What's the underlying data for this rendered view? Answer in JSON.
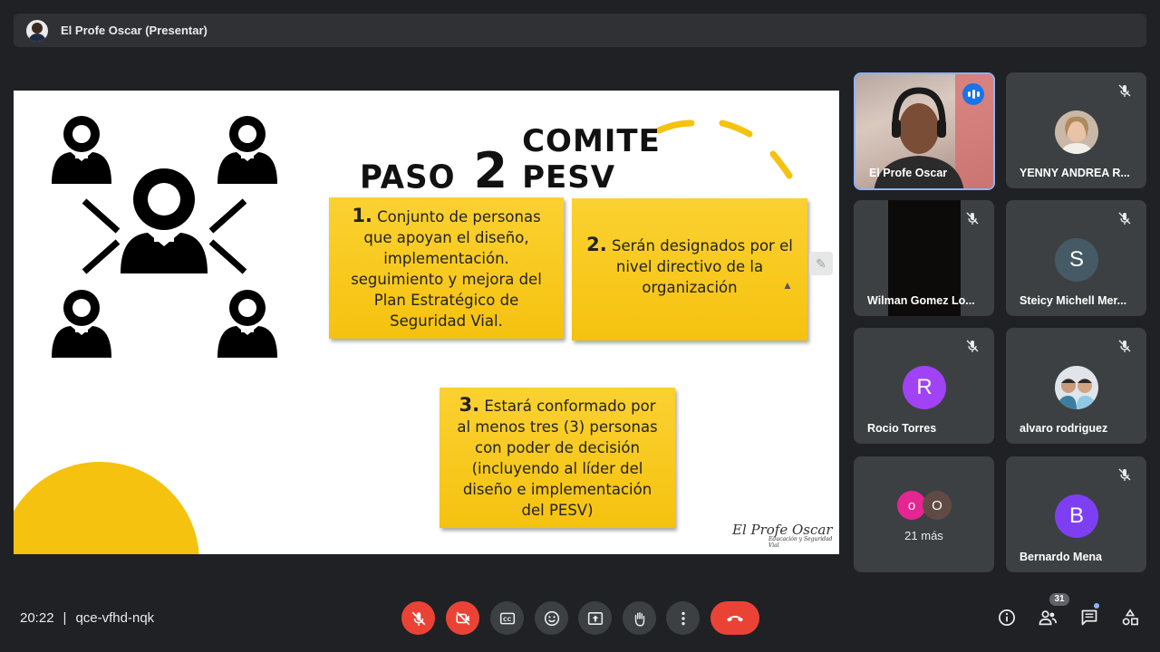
{
  "presenter_bar": {
    "title": "El Profe Oscar (Presentar)"
  },
  "slide": {
    "title_word1": "PASO",
    "title_number": "2",
    "title_word2": "COMITE PESV",
    "box1": {
      "num": "1.",
      "text": "Conjunto de personas que apoyan el diseño, implementación. seguimiento y mejora del Plan Estratégico de Seguridad Vial."
    },
    "box2": {
      "num": "2.",
      "text": "Serán designados por el nivel directivo de la organización"
    },
    "box3": {
      "num": "3.",
      "text": "Estará conformado por al menos tres (3) personas con poder de decisión (incluyendo al líder del diseño e implementación del PESV)"
    },
    "watermark": "El Profe Oscar",
    "watermark_sub": "Educación y Seguridad Vial",
    "accent_color": "#f5c20f"
  },
  "participants": [
    {
      "name": "El Profe Oscar",
      "speaking": true
    },
    {
      "name": "YENNY ANDREA R...",
      "muted": true
    },
    {
      "name": "Wilman Gomez Lo...",
      "muted": true
    },
    {
      "name": "Steicy Michell Mer...",
      "initial": "S",
      "color": "#455a64",
      "muted": true
    },
    {
      "name": "Rocio Torres",
      "initial": "R",
      "color": "#a142f4",
      "muted": true
    },
    {
      "name": "alvaro rodriguez",
      "muted": true
    },
    {
      "name": "Bernardo Mena",
      "initial": "B",
      "color": "#7e3ff2",
      "muted": true
    }
  ],
  "more_tile": {
    "dot1": "o",
    "dot2": "O",
    "text": "21 más"
  },
  "meeting": {
    "time": "20:22",
    "separator": "|",
    "code": "qce-vfhd-nqk"
  },
  "controls": {
    "mic": "mic-off-icon",
    "camera": "camera-off-icon",
    "captions": "captions-icon",
    "reactions": "emoji-icon",
    "present": "present-screen-icon",
    "raise_hand": "hand-icon",
    "more": "more-vert-icon",
    "leave": "hang-up-icon"
  },
  "right_controls": {
    "people_count": "31"
  }
}
